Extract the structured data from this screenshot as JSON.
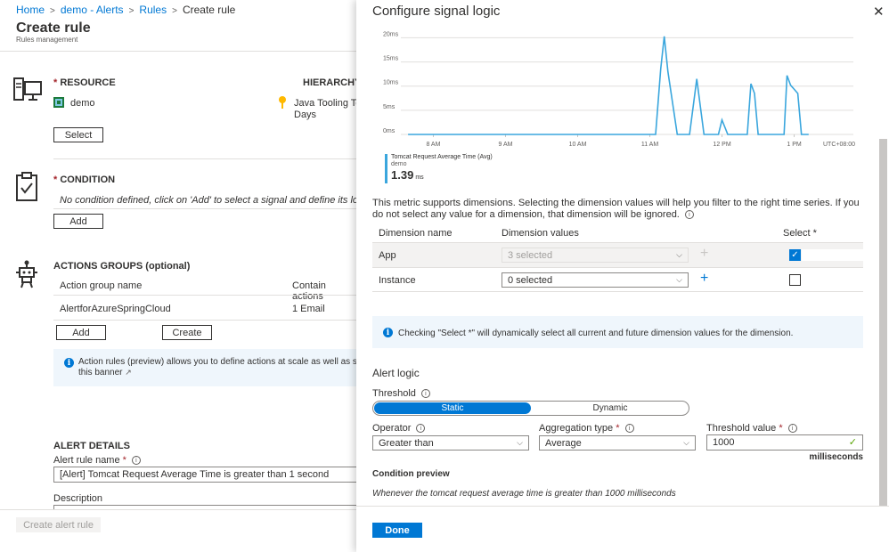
{
  "breadcrumb": {
    "items": [
      "Home",
      "demo - Alerts",
      "Rules",
      "Create rule"
    ]
  },
  "page": {
    "title": "Create rule",
    "subtitle": "Rules management"
  },
  "resource": {
    "heading": "RESOURCE",
    "hierarchy_heading": "HIERARCHY",
    "name": "demo",
    "hierarchy_line1": "Java Tooling Tests",
    "hierarchy_line2": "Days",
    "select_label": "Select"
  },
  "condition": {
    "heading": "CONDITION",
    "empty_text": "No condition defined, click on 'Add' to select a signal and define its logic",
    "add_label": "Add"
  },
  "actions": {
    "heading": "ACTIONS GROUPS (optional)",
    "col_name": "Action group name",
    "col_contain": "Contain actions",
    "row_name": "AlertforAzureSpringCloud",
    "row_count": "1 Email",
    "add_label": "Add",
    "create_label": "Create",
    "banner_text1": "Action rules (preview) allows you to define actions at scale as well as suppress action",
    "banner_text2": "this banner"
  },
  "alert_details": {
    "heading": "ALERT DETAILS",
    "name_label": "Alert rule name",
    "name_value": "[Alert] Tomcat Request Average Time is greater than 1 second",
    "desc_label": "Description",
    "create_button": "Create alert rule"
  },
  "panel": {
    "title": "Configure signal logic",
    "close": "✕",
    "done_label": "Done"
  },
  "chart_data": {
    "type": "line",
    "x_ticks": [
      "8 AM",
      "9 AM",
      "10 AM",
      "11 AM",
      "12 PM",
      "1 PM"
    ],
    "timezone": "UTC+08:00",
    "y_ticks": [
      "20ms",
      "15ms",
      "10ms",
      "5ms",
      "0ms"
    ],
    "ylim": [
      0,
      21
    ],
    "x_hours": [
      7.65,
      8,
      9,
      10,
      11,
      11.08,
      11.15,
      11.2,
      11.25,
      11.38,
      11.45,
      11.55,
      11.65,
      11.75,
      11.85,
      11.9,
      11.95,
      12.0,
      12.08,
      12.15,
      12.2,
      12.35,
      12.4,
      12.45,
      12.5,
      12.6,
      12.7,
      12.82,
      12.86,
      12.9,
      12.95,
      13.05,
      13.1,
      13.2
    ],
    "y_ms": [
      0,
      0,
      0,
      0,
      0,
      0,
      13.5,
      20.3,
      13,
      0,
      0,
      0,
      11.5,
      0,
      0,
      0,
      0,
      3,
      0,
      0,
      0,
      0,
      10.5,
      8.5,
      0,
      0,
      0,
      0,
      0,
      12.2,
      10.2,
      8.5,
      0,
      0
    ],
    "series": [
      {
        "name": "Tomcat Request Average Time (Avg)",
        "resource": "demo",
        "value": "1.39",
        "unit": "ms"
      }
    ],
    "color": "#3aa6dd",
    "legend": "bottom-left"
  },
  "dimensions": {
    "description": "This metric supports dimensions. Selecting the dimension values will help you filter to the right time series. If you do not select any value for a dimension, that dimension will be ignored.",
    "col_name": "Dimension name",
    "col_values": "Dimension values",
    "col_select": "Select *",
    "rows": [
      {
        "name": "App",
        "value": "3 selected",
        "selected": true
      },
      {
        "name": "Instance",
        "value": "0 selected",
        "selected": false
      }
    ],
    "info": "Checking \"Select *\" will dynamically select all current and future dimension values for the dimension."
  },
  "alert_logic": {
    "heading": "Alert logic",
    "threshold_label": "Threshold",
    "threshold_static": "Static",
    "threshold_dynamic": "Dynamic",
    "operator_label": "Operator",
    "operator_value": "Greater than",
    "aggregation_label": "Aggregation type",
    "aggregation_value": "Average",
    "threshold_value_label": "Threshold value",
    "threshold_value": "1000",
    "unit": "milliseconds",
    "preview_heading": "Condition preview",
    "preview_text": "Whenever the tomcat request average time is greater than 1000 milliseconds"
  },
  "colors": {
    "accent": "#0078d4",
    "required": "#a4262c",
    "info_bg": "#eff6fc"
  }
}
